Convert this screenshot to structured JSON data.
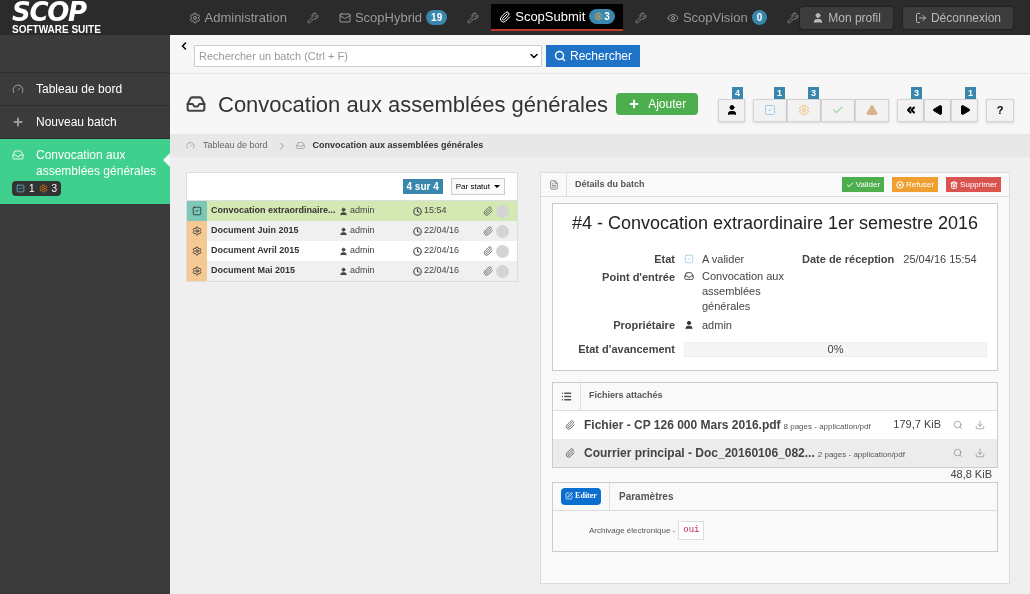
{
  "logo": {
    "title": "SCOP",
    "subtitle": "SOFTWARE SUITE"
  },
  "nav": {
    "tabs": [
      {
        "label": "Administration",
        "selected": false
      },
      {
        "label": "ScopHybrid",
        "badge": {
          "value": "19",
          "kind": "count"
        },
        "selected": false
      },
      {
        "label": "ScopSubmit",
        "badge": {
          "value": "3",
          "kind": "processing"
        },
        "selected": true
      },
      {
        "label": "ScopVision",
        "badge": {
          "value": "0",
          "kind": "count"
        },
        "selected": false
      }
    ],
    "account": [
      "Mon profil",
      "Déconnexion"
    ]
  },
  "sidebar": {
    "items": [
      {
        "label": "Tableau de bord",
        "selected": false
      },
      {
        "label": "Nouveau batch",
        "selected": false
      },
      {
        "label": "Convocation aux assemblées générales",
        "selected": true,
        "counts": [
          {
            "kind": "to_validate",
            "value": "1"
          },
          {
            "kind": "processing",
            "value": "3"
          }
        ]
      }
    ]
  },
  "search": {
    "placeholder": "Rechercher un batch (Ctrl + F)",
    "button": "Rechercher"
  },
  "page": {
    "title": "Convocation aux assemblées générales",
    "add_button": "Ajouter",
    "toolbar": [
      [
        {
          "kind": "user",
          "badge": "4"
        }
      ],
      [
        {
          "kind": "to_validate",
          "badge": "1"
        },
        {
          "kind": "processing",
          "badge": "3"
        },
        {
          "kind": "validated"
        },
        {
          "kind": "error"
        }
      ],
      [
        {
          "kind": "first",
          "badge": "3"
        },
        {
          "kind": "previous"
        },
        {
          "kind": "next",
          "badge": "1"
        }
      ],
      [
        {
          "label": "?"
        }
      ]
    ]
  },
  "breadcrumb": [
    "Tableau de bord",
    "Convocation aux assemblées générales"
  ],
  "batches": {
    "count": "4 sur 4",
    "sort": "Par statut",
    "rows": [
      {
        "kind": "to_validate",
        "name": "Convocation extraordinaire...",
        "owner": "admin",
        "time": "15:54",
        "selected": true
      },
      {
        "kind": "processing",
        "name": "Document Juin 2015",
        "owner": "admin",
        "time": "22/04/16",
        "selected": false
      },
      {
        "kind": "processing",
        "name": "Document Avril 2015",
        "owner": "admin",
        "time": "22/04/16",
        "selected": false
      },
      {
        "kind": "processing",
        "name": "Document Mai 2015",
        "owner": "admin",
        "time": "22/04/16",
        "selected": false
      }
    ]
  },
  "details": {
    "header": "Détails du batch",
    "actions": [
      {
        "label": "Valider",
        "kind": "validate"
      },
      {
        "label": "Refuser",
        "kind": "refuse"
      },
      {
        "label": "Supprimer",
        "kind": "delete"
      }
    ],
    "heading": "#4 - Convocation extraordinaire 1er semestre 2016",
    "state_label": "Etat",
    "state": "A valider",
    "date_label": "Date de réception",
    "date": "25/04/16 15:54",
    "entry_label": "Point d'entrée",
    "entry": "Convocation aux assemblées générales",
    "owner_label": "Propriétaire",
    "owner": "admin",
    "progress_label": "Etat d'avancement",
    "progress": {
      "level": 0,
      "reading": "0%"
    }
  },
  "files": {
    "header": "Fichiers attachés",
    "rows": [
      {
        "name": "Fichier - CP 126 000 Mars 2016.pdf",
        "meta": "8 pages - application/pdf",
        "size": "179,7 KiB",
        "selected": false
      },
      {
        "name": "Courrier principal - Doc_20160106_082...",
        "meta": "2 pages - application/pdf",
        "size": "48,8 KiB",
        "selected": true
      }
    ]
  },
  "params": {
    "edit_button": "Editer",
    "header": "Paramètres",
    "items": [
      {
        "label": "Archivage électronique -",
        "value": "oui"
      }
    ]
  }
}
